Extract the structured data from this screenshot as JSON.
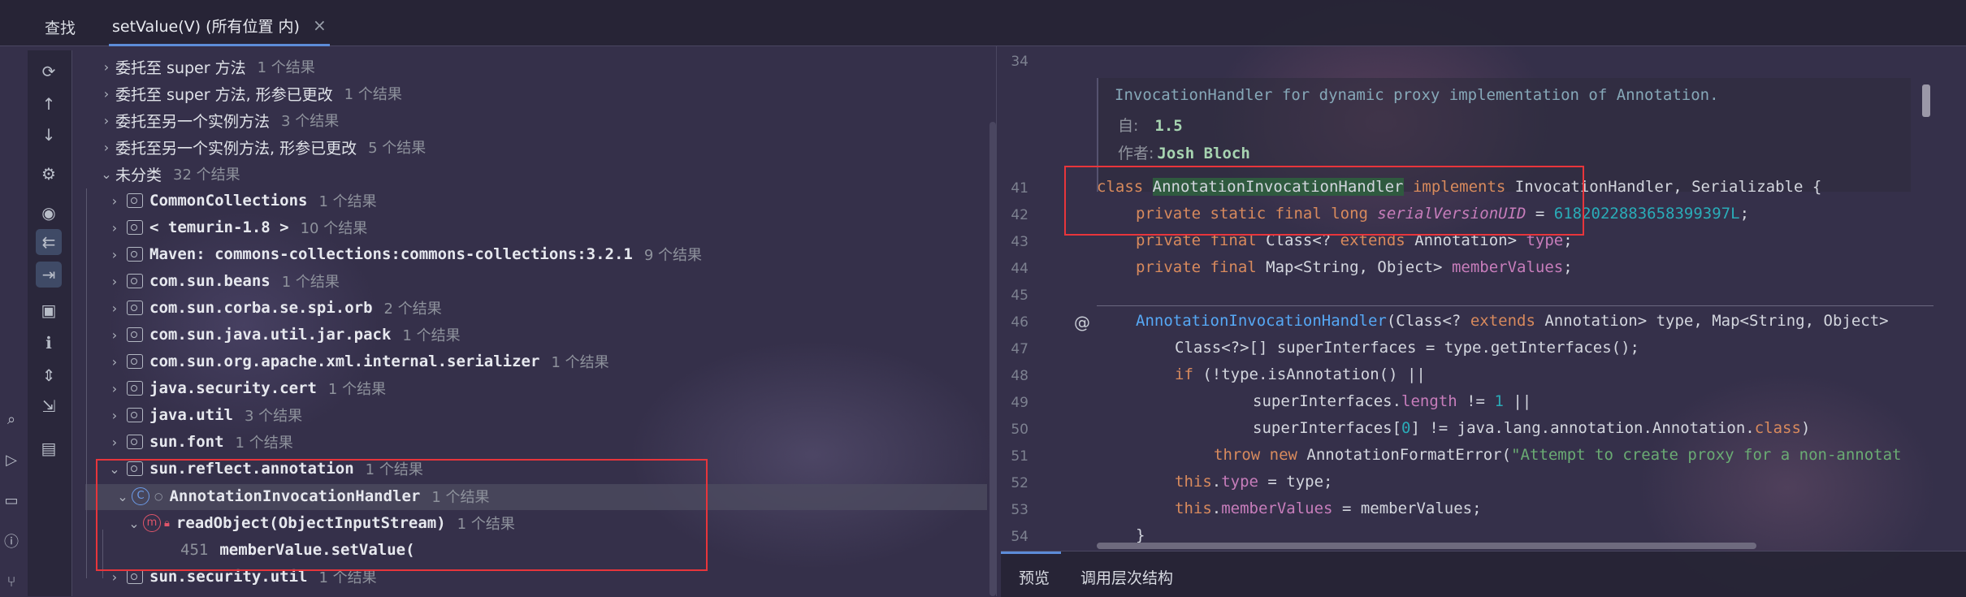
{
  "top_tabs": {
    "find_label": "查找",
    "search_title": "setValue(V) (所有位置 内)",
    "close_glyph": "×"
  },
  "tree": {
    "rows": [
      {
        "label": "委托至 super 方法",
        "count": "1 个结果"
      },
      {
        "label": "委托至 super 方法, 形参已更改",
        "count": "1 个结果"
      },
      {
        "label": "委托至另一个实例方法",
        "count": "3 个结果"
      },
      {
        "label": "委托至另一个实例方法, 形参已更改",
        "count": "5 个结果"
      },
      {
        "label": "未分类",
        "count": "32 个结果"
      },
      {
        "label": "CommonCollections",
        "count": "1 个结果"
      },
      {
        "label": "< temurin-1.8 >",
        "count": "10 个结果"
      },
      {
        "label": "Maven: commons-collections:commons-collections:3.2.1",
        "count": "9 个结果"
      },
      {
        "label": "com.sun.beans",
        "count": "1 个结果"
      },
      {
        "label": "com.sun.corba.se.spi.orb",
        "count": "2 个结果"
      },
      {
        "label": "com.sun.java.util.jar.pack",
        "count": "1 个结果"
      },
      {
        "label": "com.sun.org.apache.xml.internal.serializer",
        "count": "1 个结果"
      },
      {
        "label": "java.security.cert",
        "count": "1 个结果"
      },
      {
        "label": "java.util",
        "count": "3 个结果"
      },
      {
        "label": "sun.font",
        "count": "1 个结果"
      },
      {
        "label": "sun.reflect.annotation",
        "count": "1 个结果"
      },
      {
        "label": "AnnotationInvocationHandler",
        "count": "1 个结果"
      },
      {
        "label": "readObject(ObjectInputStream)",
        "count": "1 个结果"
      },
      {
        "label": "memberValue.setValue(",
        "line": "451"
      },
      {
        "label": "sun.security.util",
        "count": "1 个结果"
      }
    ]
  },
  "editor": {
    "doc": {
      "summary": "InvocationHandler for dynamic proxy implementation of Annotation.",
      "since_label": "自:",
      "since_value": "1.5",
      "author_label": "作者:",
      "author_value": "Josh Bloch"
    },
    "line_numbers": [
      "34",
      "41",
      "42",
      "43",
      "44",
      "45",
      "46",
      "47",
      "48",
      "49",
      "50",
      "51",
      "52",
      "53",
      "54"
    ],
    "code": {
      "l41_kw": "class ",
      "l41_cls": "AnnotationInvocationHandler",
      "l41_kw2": " implements ",
      "l41_rest": "InvocationHandler, Serializable {",
      "l42_kw": "private static final long ",
      "l42_field": "serialVersionUID",
      "l42_eq": " = ",
      "l42_num": "6182022883658399397L",
      "l42_end": ";",
      "l43_kw": "private final ",
      "l43_type": "Class<? ",
      "l43_kw2": "extends",
      "l43_type2": " Annotation> ",
      "l43_field": "type",
      "l43_end": ";",
      "l44_kw": "private final ",
      "l44_type": "Map<String, Object> ",
      "l44_field": "memberValues",
      "l44_end": ";",
      "l46_fn": "AnnotationInvocationHandler",
      "l46_a": "(Class<? ",
      "l46_kw": "extends",
      "l46_b": " Annotation> type, Map<String, Object> ",
      "l47": "Class<?>[] superInterfaces = type.getInterfaces();",
      "l48_kw": "if",
      "l48_rest": " (!type.isAnnotation() ||",
      "l49_a": "superInterfaces.",
      "l49_field": "length",
      "l49_b": " != ",
      "l49_num": "1",
      "l49_c": " ||",
      "l50_a": "superInterfaces[",
      "l50_num": "0",
      "l50_b": "] != java.lang.annotation.Annotation.",
      "l50_kw": "class",
      "l50_c": ")",
      "l51_kw": "throw new ",
      "l51_a": "AnnotationFormatError(",
      "l51_str": "\"Attempt to create proxy for a non-annotat",
      "l52_kw": "this",
      "l52_a": ".",
      "l52_field": "type",
      "l52_b": " = type;",
      "l53_kw": "this",
      "l53_a": ".",
      "l53_field": "memberValues",
      "l53_b": " = memberValues;",
      "l54": "}"
    }
  },
  "bottom_tabs": {
    "preview": "预览",
    "call_hierarchy": "调用层次结构"
  },
  "colors": {
    "accent": "#5d8cd8",
    "highlight_box": "#e8353b"
  }
}
